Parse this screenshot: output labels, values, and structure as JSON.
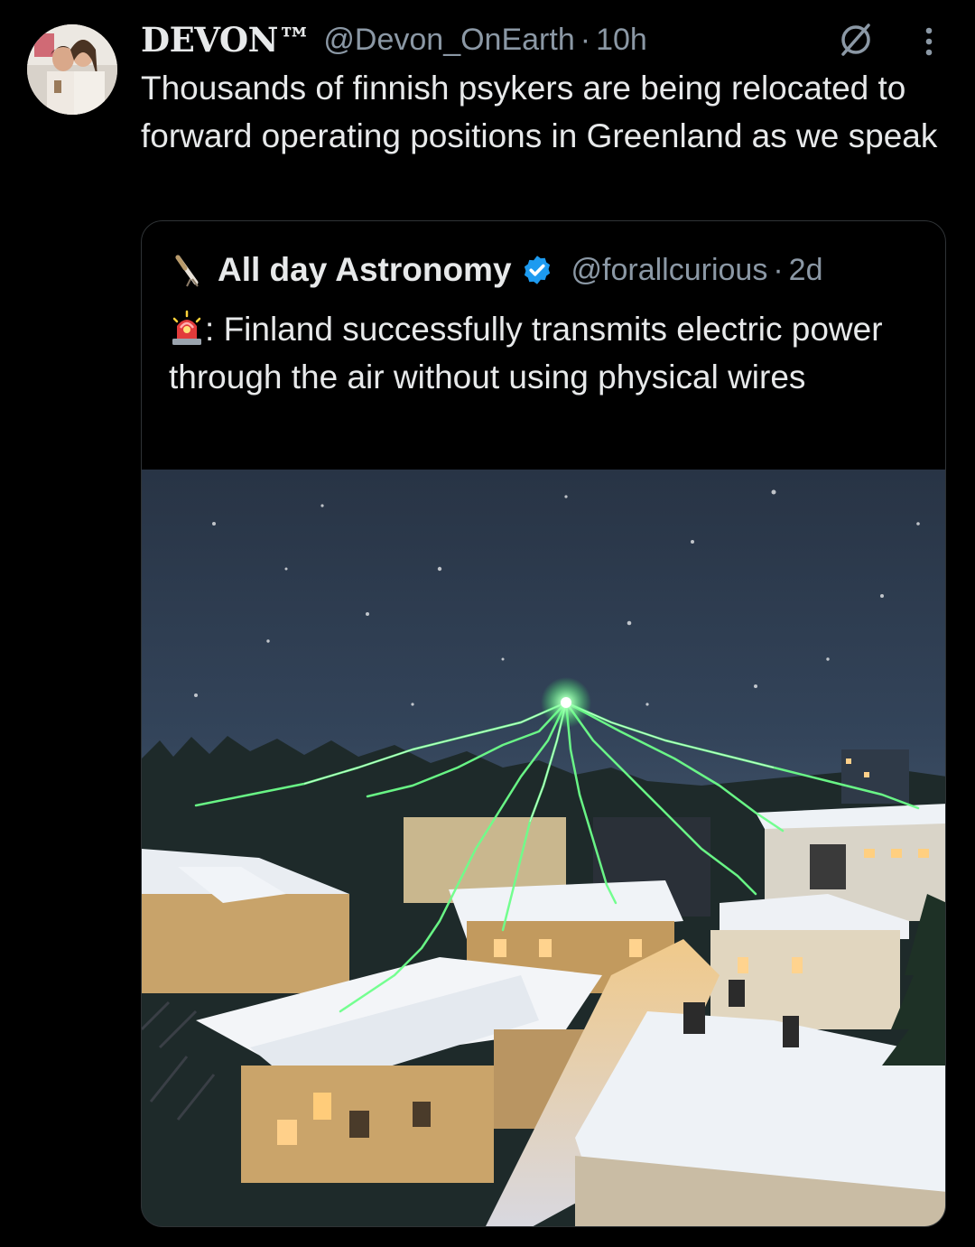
{
  "tweet": {
    "display_name": "DEVON™",
    "handle": "@Devon_OnEarth",
    "separator": "·",
    "time": "10h",
    "text": "Thousands of finnish psykers are being relocated to forward operating positions in Greenland as we speak"
  },
  "quote": {
    "display_name": "All day Astronomy",
    "handle": "@forallcurious",
    "separator": "·",
    "time": "2d",
    "emoji_prefix": ": ",
    "text": "Finland successfully transmits electric power through the air without using physical wires"
  },
  "icons": {
    "verified_color": "#1d9bf0",
    "badge": "slashed-circle-icon",
    "more": "more-vertical-icon"
  },
  "colors": {
    "background": "#000000",
    "text": "#e7e9ea",
    "muted": "#8b98a5",
    "border": "#2f3336",
    "lightning": "#6dff8a"
  }
}
